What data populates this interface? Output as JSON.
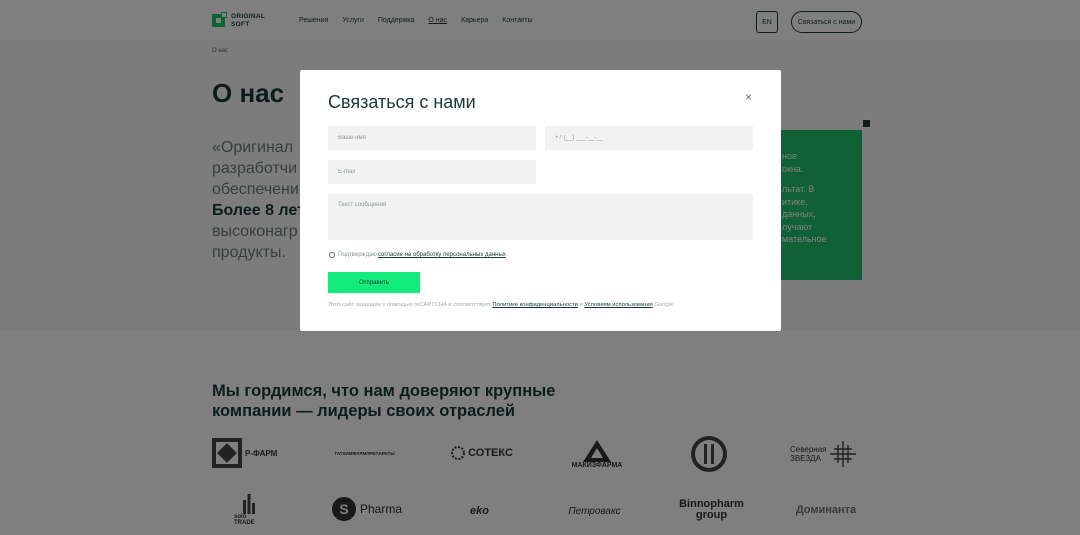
{
  "header": {
    "logo_line1": "ORIGINAL",
    "logo_line2": "SOFT",
    "nav": [
      "Решения",
      "Услуги",
      "Поддержка",
      "О нас",
      "Карьера",
      "Контакты"
    ],
    "lang": "EN",
    "contact_button": "Связаться с нами"
  },
  "about": {
    "breadcrumb": "О нас",
    "title": "О нас",
    "lead_lines": [
      "«Оригинал",
      "разработчи",
      "обеспечени"
    ],
    "lead_bold": "Более 8 лет",
    "lead_lines2": [
      "высоконагр",
      "продукты."
    ],
    "card_lines": [
      "ное",
      "окна.",
      "льтат. В",
      "итике,",
      "данных,",
      "лучают",
      "мательное"
    ]
  },
  "partners": {
    "title_line1": "Мы гордимся, что нам доверяют крупные",
    "title_line2": "компании — лидеры своих отраслей",
    "logos": [
      "Р-ФАРМ",
      "ТАТХИМФАРМПРЕПАРАТЫ",
      "СОТЕКС",
      "МАКИЗФАРМА",
      "",
      "Северная ЗВЕЗДА",
      "solo TRADE",
      "Pharma",
      "eko",
      "Петровакс",
      "Binnopharm group",
      "Доминанта"
    ]
  },
  "modal": {
    "title": "Связаться с нами",
    "close": "×",
    "name_placeholder": "Ваше имя",
    "phone_placeholder": "+7 (__) ___-__-__",
    "email_placeholder": "E-mail",
    "message_placeholder": "Текст сообщения",
    "consent_text": "Подтверждаю",
    "consent_link": "согласие на обработку персональных данных",
    "submit": "Отправить",
    "recaptcha_text": "Этот сайт защищен с помощью reCAPTCHA и соответствует",
    "privacy_link": "Политике конфиденциальности",
    "and": "и",
    "terms_link": "Условиям использования",
    "google": "Google"
  }
}
